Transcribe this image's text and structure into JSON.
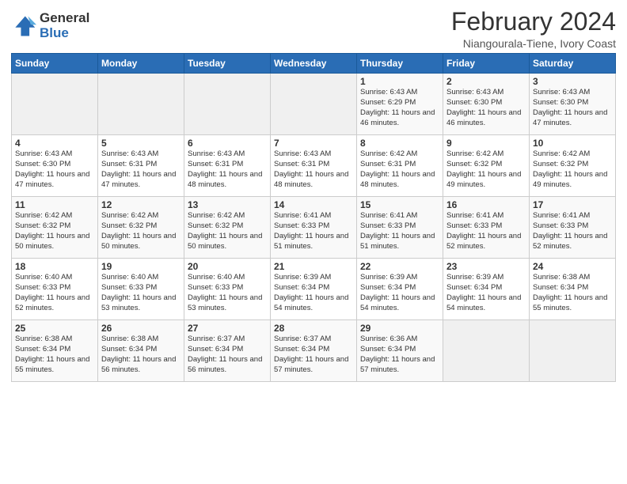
{
  "header": {
    "logo_general": "General",
    "logo_blue": "Blue",
    "main_title": "February 2024",
    "subtitle": "Niangourala-Tiene, Ivory Coast"
  },
  "weekdays": [
    "Sunday",
    "Monday",
    "Tuesday",
    "Wednesday",
    "Thursday",
    "Friday",
    "Saturday"
  ],
  "weeks": [
    [
      {
        "day": "",
        "info": ""
      },
      {
        "day": "",
        "info": ""
      },
      {
        "day": "",
        "info": ""
      },
      {
        "day": "",
        "info": ""
      },
      {
        "day": "1",
        "info": "Sunrise: 6:43 AM\nSunset: 6:29 PM\nDaylight: 11 hours\nand 46 minutes."
      },
      {
        "day": "2",
        "info": "Sunrise: 6:43 AM\nSunset: 6:30 PM\nDaylight: 11 hours\nand 46 minutes."
      },
      {
        "day": "3",
        "info": "Sunrise: 6:43 AM\nSunset: 6:30 PM\nDaylight: 11 hours\nand 47 minutes."
      }
    ],
    [
      {
        "day": "4",
        "info": "Sunrise: 6:43 AM\nSunset: 6:30 PM\nDaylight: 11 hours\nand 47 minutes."
      },
      {
        "day": "5",
        "info": "Sunrise: 6:43 AM\nSunset: 6:31 PM\nDaylight: 11 hours\nand 47 minutes."
      },
      {
        "day": "6",
        "info": "Sunrise: 6:43 AM\nSunset: 6:31 PM\nDaylight: 11 hours\nand 48 minutes."
      },
      {
        "day": "7",
        "info": "Sunrise: 6:43 AM\nSunset: 6:31 PM\nDaylight: 11 hours\nand 48 minutes."
      },
      {
        "day": "8",
        "info": "Sunrise: 6:42 AM\nSunset: 6:31 PM\nDaylight: 11 hours\nand 48 minutes."
      },
      {
        "day": "9",
        "info": "Sunrise: 6:42 AM\nSunset: 6:32 PM\nDaylight: 11 hours\nand 49 minutes."
      },
      {
        "day": "10",
        "info": "Sunrise: 6:42 AM\nSunset: 6:32 PM\nDaylight: 11 hours\nand 49 minutes."
      }
    ],
    [
      {
        "day": "11",
        "info": "Sunrise: 6:42 AM\nSunset: 6:32 PM\nDaylight: 11 hours\nand 50 minutes."
      },
      {
        "day": "12",
        "info": "Sunrise: 6:42 AM\nSunset: 6:32 PM\nDaylight: 11 hours\nand 50 minutes."
      },
      {
        "day": "13",
        "info": "Sunrise: 6:42 AM\nSunset: 6:32 PM\nDaylight: 11 hours\nand 50 minutes."
      },
      {
        "day": "14",
        "info": "Sunrise: 6:41 AM\nSunset: 6:33 PM\nDaylight: 11 hours\nand 51 minutes."
      },
      {
        "day": "15",
        "info": "Sunrise: 6:41 AM\nSunset: 6:33 PM\nDaylight: 11 hours\nand 51 minutes."
      },
      {
        "day": "16",
        "info": "Sunrise: 6:41 AM\nSunset: 6:33 PM\nDaylight: 11 hours\nand 52 minutes."
      },
      {
        "day": "17",
        "info": "Sunrise: 6:41 AM\nSunset: 6:33 PM\nDaylight: 11 hours\nand 52 minutes."
      }
    ],
    [
      {
        "day": "18",
        "info": "Sunrise: 6:40 AM\nSunset: 6:33 PM\nDaylight: 11 hours\nand 52 minutes."
      },
      {
        "day": "19",
        "info": "Sunrise: 6:40 AM\nSunset: 6:33 PM\nDaylight: 11 hours\nand 53 minutes."
      },
      {
        "day": "20",
        "info": "Sunrise: 6:40 AM\nSunset: 6:33 PM\nDaylight: 11 hours\nand 53 minutes."
      },
      {
        "day": "21",
        "info": "Sunrise: 6:39 AM\nSunset: 6:34 PM\nDaylight: 11 hours\nand 54 minutes."
      },
      {
        "day": "22",
        "info": "Sunrise: 6:39 AM\nSunset: 6:34 PM\nDaylight: 11 hours\nand 54 minutes."
      },
      {
        "day": "23",
        "info": "Sunrise: 6:39 AM\nSunset: 6:34 PM\nDaylight: 11 hours\nand 54 minutes."
      },
      {
        "day": "24",
        "info": "Sunrise: 6:38 AM\nSunset: 6:34 PM\nDaylight: 11 hours\nand 55 minutes."
      }
    ],
    [
      {
        "day": "25",
        "info": "Sunrise: 6:38 AM\nSunset: 6:34 PM\nDaylight: 11 hours\nand 55 minutes."
      },
      {
        "day": "26",
        "info": "Sunrise: 6:38 AM\nSunset: 6:34 PM\nDaylight: 11 hours\nand 56 minutes."
      },
      {
        "day": "27",
        "info": "Sunrise: 6:37 AM\nSunset: 6:34 PM\nDaylight: 11 hours\nand 56 minutes."
      },
      {
        "day": "28",
        "info": "Sunrise: 6:37 AM\nSunset: 6:34 PM\nDaylight: 11 hours\nand 57 minutes."
      },
      {
        "day": "29",
        "info": "Sunrise: 6:36 AM\nSunset: 6:34 PM\nDaylight: 11 hours\nand 57 minutes."
      },
      {
        "day": "",
        "info": ""
      },
      {
        "day": "",
        "info": ""
      }
    ]
  ]
}
